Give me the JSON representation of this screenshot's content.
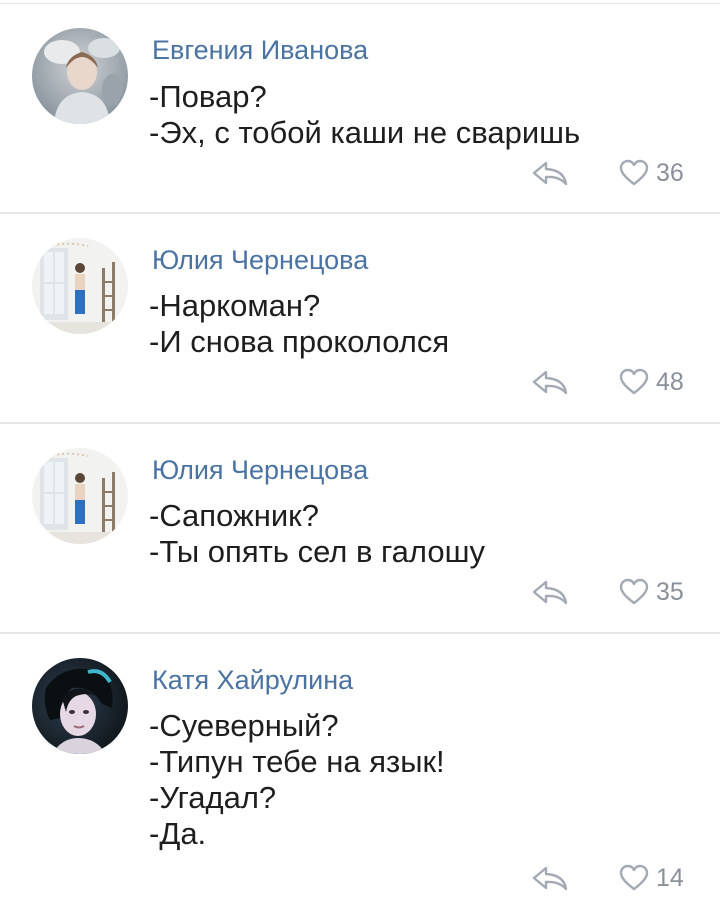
{
  "colors": {
    "author_name": "#4a73a3",
    "text": "#1e1e1e",
    "icon": "#a3aab3",
    "divider": "#e4e6ea"
  },
  "comments": [
    {
      "author": "Евгения Иванова",
      "lines": [
        "-Повар?",
        "-Эх, с тобой каши не сваришь"
      ],
      "likes": "36",
      "avatar_icon": "avatar-photo-woman-light"
    },
    {
      "author": "Юлия Чернецова",
      "lines": [
        "-Наркоман?",
        "-И снова прокололся"
      ],
      "likes": "48",
      "avatar_icon": "avatar-photo-room"
    },
    {
      "author": "Юлия Чернецова",
      "lines": [
        "-Сапожник?",
        "-Ты опять сел в галошу"
      ],
      "likes": "35",
      "avatar_icon": "avatar-photo-room"
    },
    {
      "author": "Катя Хайрулина",
      "lines": [
        "-Суеверный?",
        "-Типун тебе на язык!",
        "-Угадал?",
        "-Да."
      ],
      "likes": "14",
      "avatar_icon": "avatar-photo-dark"
    }
  ]
}
